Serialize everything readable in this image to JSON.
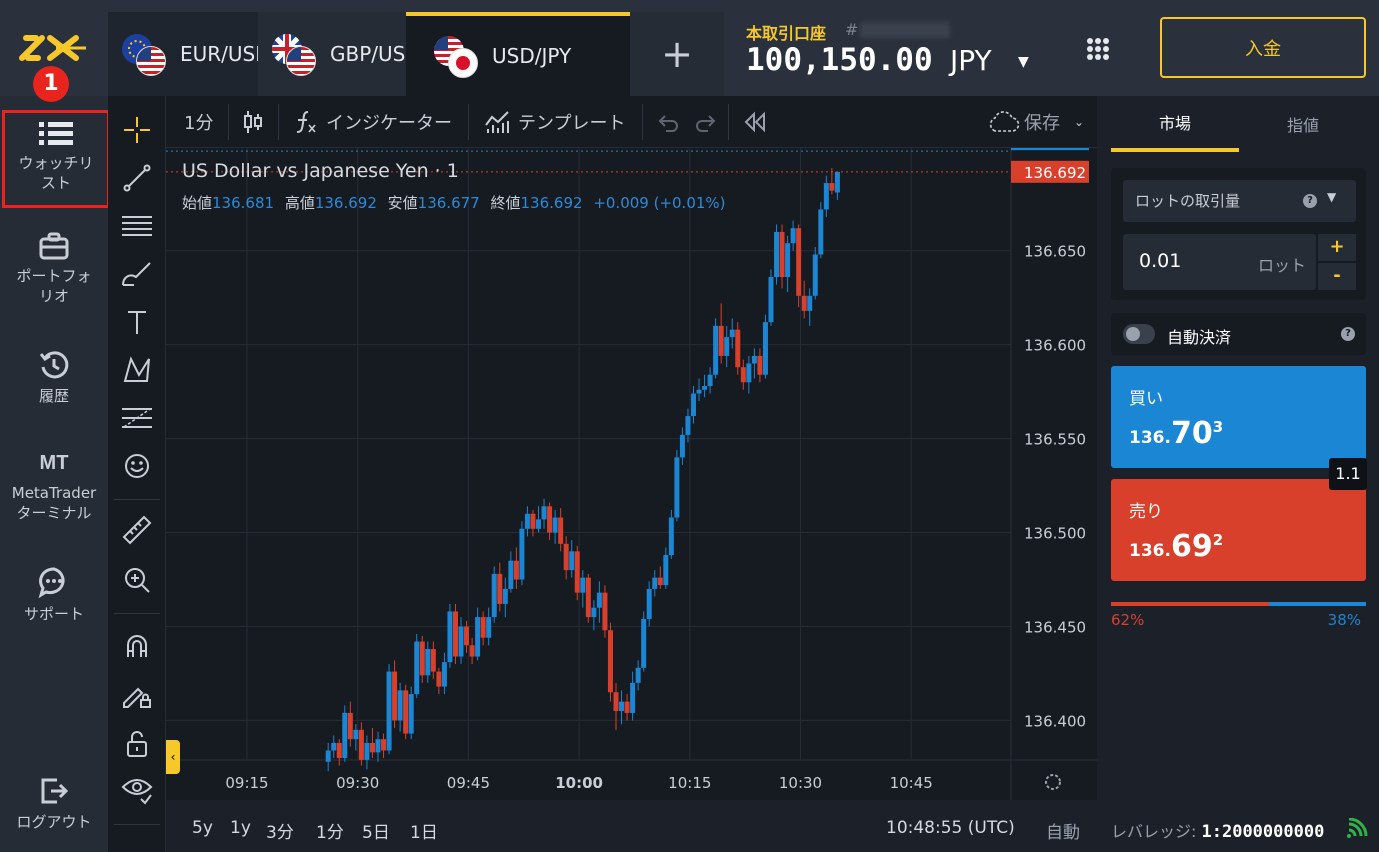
{
  "header": {
    "marker": "1",
    "tabs": [
      {
        "label": "EUR/USD",
        "flags": [
          "EU",
          "US"
        ],
        "active": false
      },
      {
        "label": "GBP/USD",
        "flags": [
          "GB",
          "US"
        ],
        "active": false
      },
      {
        "label": "USD/JPY",
        "flags": [
          "US",
          "JP"
        ],
        "active": true
      }
    ],
    "add_tab": "+",
    "account_label": "本取引口座",
    "account_hash": "#",
    "balance": "100,150.00",
    "currency": "JPY",
    "deposit": "入金"
  },
  "sidebar": {
    "items": [
      {
        "label": "ウォッチリスト",
        "icon": "list-icon"
      },
      {
        "label": "ポートフォリオ",
        "icon": "briefcase-icon"
      },
      {
        "label": "履歴",
        "icon": "history-icon"
      },
      {
        "label": "MetaTraderターミナル",
        "icon_text": "MT"
      },
      {
        "label": "サポート",
        "icon": "chat-icon"
      },
      {
        "label": "ログアウト",
        "icon": "logout-icon"
      }
    ]
  },
  "toolbar": {
    "interval": "1分",
    "indicators": "インジケーター",
    "templates": "テンプレート",
    "save": "保存"
  },
  "chart": {
    "title": "US Dollar vs Japanese Yen · 1",
    "ohlc": {
      "open_label": "始値",
      "open": "136.681",
      "high_label": "高値",
      "high": "136.692",
      "low_label": "安値",
      "low": "136.677",
      "close_label": "終値",
      "close": "136.692",
      "change": "+0.009 (+0.01%)"
    }
  },
  "chart_data": {
    "type": "candlestick",
    "title": "US Dollar vs Japanese Yen · 1",
    "x_ticks": [
      "09:15",
      "09:30",
      "09:45",
      "10:00",
      "10:15",
      "10:30",
      "10:45"
    ],
    "y_ticks": [
      "136.400",
      "136.450",
      "136.500",
      "136.550",
      "136.600",
      "136.650"
    ],
    "ylim": [
      136.38,
      136.71
    ],
    "price_labels": [
      {
        "value": "136.703",
        "color": "#1b86d3"
      },
      {
        "value": "136.692",
        "color": "#d8402c"
      }
    ],
    "candle_colors": {
      "up": "#1b86d3",
      "down": "#d8402c"
    },
    "start_time": "09:26",
    "candles": [
      [
        136.378,
        136.388,
        136.373,
        136.384
      ],
      [
        136.384,
        136.392,
        136.38,
        136.388
      ],
      [
        136.388,
        136.39,
        136.376,
        136.38
      ],
      [
        136.38,
        136.408,
        136.378,
        136.404
      ],
      [
        136.404,
        136.41,
        136.386,
        136.39
      ],
      [
        136.39,
        136.398,
        136.384,
        136.395
      ],
      [
        136.395,
        136.399,
        136.376,
        136.379
      ],
      [
        136.379,
        136.392,
        136.374,
        136.388
      ],
      [
        136.388,
        136.396,
        136.38,
        136.383
      ],
      [
        136.383,
        136.394,
        136.378,
        136.39
      ],
      [
        136.39,
        136.393,
        136.38,
        136.384
      ],
      [
        136.384,
        136.43,
        136.382,
        136.426
      ],
      [
        136.426,
        136.432,
        136.396,
        136.4
      ],
      [
        136.4,
        136.42,
        136.394,
        136.416
      ],
      [
        136.416,
        136.419,
        136.39,
        136.393
      ],
      [
        136.393,
        136.418,
        136.39,
        136.414
      ],
      [
        136.414,
        136.446,
        136.412,
        136.442
      ],
      [
        136.442,
        136.445,
        136.42,
        136.424
      ],
      [
        136.424,
        136.442,
        136.42,
        136.438
      ],
      [
        136.438,
        136.442,
        136.422,
        136.426
      ],
      [
        136.426,
        136.428,
        136.414,
        136.418
      ],
      [
        136.418,
        136.436,
        136.414,
        136.431
      ],
      [
        136.431,
        136.462,
        136.428,
        136.458
      ],
      [
        136.458,
        136.462,
        136.43,
        136.434
      ],
      [
        136.434,
        136.455,
        136.43,
        136.45
      ],
      [
        136.45,
        136.453,
        136.436,
        136.44
      ],
      [
        136.44,
        136.444,
        136.43,
        136.434
      ],
      [
        136.434,
        136.46,
        136.432,
        136.455
      ],
      [
        136.455,
        136.458,
        136.44,
        136.444
      ],
      [
        136.444,
        136.46,
        136.44,
        136.455
      ],
      [
        136.455,
        136.482,
        136.452,
        136.478
      ],
      [
        136.478,
        136.484,
        136.458,
        136.462
      ],
      [
        136.462,
        136.476,
        136.455,
        136.47
      ],
      [
        136.47,
        136.49,
        136.468,
        136.485
      ],
      [
        136.485,
        136.492,
        136.47,
        136.475
      ],
      [
        136.475,
        136.506,
        136.472,
        136.502
      ],
      [
        136.502,
        136.514,
        136.498,
        136.51
      ],
      [
        136.51,
        136.512,
        136.498,
        136.502
      ],
      [
        136.502,
        136.514,
        136.5,
        136.507
      ],
      [
        136.507,
        136.518,
        136.502,
        136.514
      ],
      [
        136.514,
        136.516,
        136.496,
        136.5
      ],
      [
        136.5,
        136.512,
        136.494,
        136.508
      ],
      [
        136.508,
        136.513,
        136.49,
        136.494
      ],
      [
        136.494,
        136.498,
        136.475,
        136.48
      ],
      [
        136.48,
        136.496,
        136.476,
        136.49
      ],
      [
        136.49,
        136.493,
        136.464,
        136.468
      ],
      [
        136.468,
        136.48,
        136.46,
        136.476
      ],
      [
        136.476,
        136.478,
        136.452,
        136.455
      ],
      [
        136.455,
        136.464,
        136.448,
        136.46
      ],
      [
        136.46,
        136.474,
        136.452,
        136.468
      ],
      [
        136.468,
        136.472,
        136.444,
        136.448
      ],
      [
        136.448,
        136.452,
        136.41,
        136.415
      ],
      [
        136.415,
        136.42,
        136.395,
        136.405
      ],
      [
        136.405,
        136.416,
        136.398,
        136.41
      ],
      [
        136.41,
        136.414,
        136.4,
        136.404
      ],
      [
        136.404,
        136.426,
        136.4,
        136.42
      ],
      [
        136.42,
        136.432,
        136.416,
        136.428
      ],
      [
        136.428,
        136.458,
        136.426,
        136.454
      ],
      [
        136.454,
        136.474,
        136.45,
        136.47
      ],
      [
        136.47,
        136.48,
        136.466,
        136.476
      ],
      [
        136.476,
        136.482,
        136.47,
        136.472
      ],
      [
        136.472,
        136.492,
        136.47,
        136.488
      ],
      [
        136.488,
        136.512,
        136.486,
        136.508
      ],
      [
        136.508,
        136.544,
        136.506,
        136.54
      ],
      [
        136.54,
        136.556,
        136.536,
        136.552
      ],
      [
        136.552,
        136.566,
        136.548,
        136.562
      ],
      [
        136.562,
        136.578,
        136.558,
        136.574
      ],
      [
        136.574,
        136.582,
        136.57,
        136.576
      ],
      [
        136.576,
        136.584,
        136.572,
        136.578
      ],
      [
        136.578,
        136.588,
        136.574,
        136.584
      ],
      [
        136.584,
        136.614,
        136.582,
        136.61
      ],
      [
        136.61,
        136.622,
        136.59,
        136.594
      ],
      [
        136.594,
        136.61,
        136.588,
        136.604
      ],
      [
        136.604,
        136.614,
        136.598,
        136.608
      ],
      [
        136.608,
        136.612,
        136.584,
        136.588
      ],
      [
        136.588,
        136.592,
        136.576,
        136.58
      ],
      [
        136.58,
        136.594,
        136.574,
        136.59
      ],
      [
        136.59,
        136.598,
        136.582,
        136.594
      ],
      [
        136.594,
        136.598,
        136.58,
        136.584
      ],
      [
        136.584,
        136.616,
        136.582,
        136.612
      ],
      [
        136.612,
        136.64,
        136.61,
        136.636
      ],
      [
        136.636,
        136.664,
        136.632,
        136.66
      ],
      [
        136.66,
        136.664,
        136.63,
        136.636
      ],
      [
        136.636,
        136.658,
        136.628,
        136.654
      ],
      [
        136.654,
        136.666,
        136.65,
        136.662
      ],
      [
        136.662,
        136.664,
        136.62,
        136.626
      ],
      [
        136.626,
        136.634,
        136.614,
        136.618
      ],
      [
        136.618,
        136.63,
        136.61,
        136.626
      ],
      [
        136.626,
        136.652,
        136.624,
        136.648
      ],
      [
        136.648,
        136.676,
        136.646,
        136.672
      ],
      [
        136.672,
        136.69,
        136.668,
        136.686
      ],
      [
        136.686,
        136.694,
        136.68,
        136.682
      ],
      [
        136.681,
        136.692,
        136.677,
        136.692
      ]
    ]
  },
  "bottombar": {
    "ranges": [
      "5y",
      "1y",
      "3分",
      "1分",
      "5日",
      "1日"
    ],
    "time": "10:48:55 (UTC)",
    "auto": "自動"
  },
  "panel": {
    "tabs": [
      "市場",
      "指値"
    ],
    "lot_select": "ロットの取引量",
    "lot_value": "0.01",
    "lot_unit": "ロット",
    "plus": "+",
    "minus": "-",
    "auto_close": "自動決済",
    "buy": {
      "label": "買い",
      "p1": "136.",
      "p2": "70",
      "p3": "3"
    },
    "sell": {
      "label": "売り",
      "p1": "136.",
      "p2": "69",
      "p3": "2"
    },
    "spread": "1.1",
    "sentiment": {
      "sell_pct": "62%",
      "buy_pct": "38%",
      "sell_fraction": 0.62
    },
    "leverage_label": "レバレッジ:",
    "leverage": "1:2000000000"
  },
  "colors": {
    "accent": "#f6c82a",
    "buy": "#1b86d3",
    "sell": "#d8402c",
    "highlight": "#e8241c"
  }
}
